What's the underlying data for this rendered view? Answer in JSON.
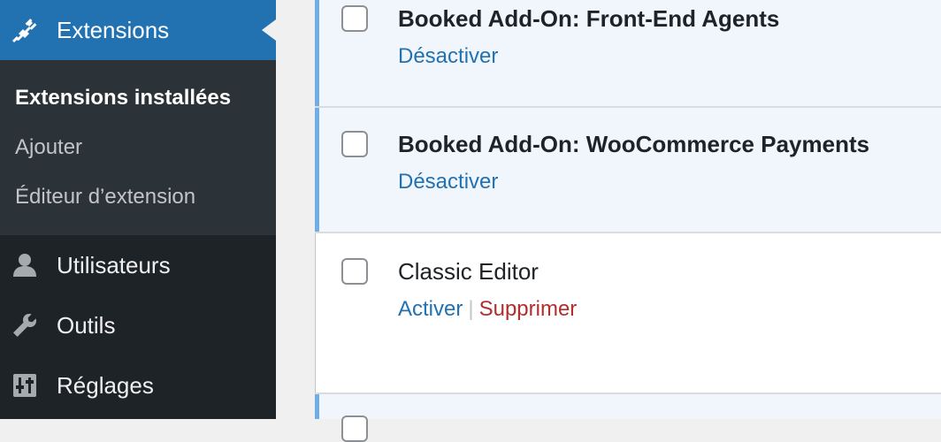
{
  "sidebar": {
    "active_menu": {
      "label": "Extensions",
      "icon": "plugin-icon"
    },
    "submenu": [
      {
        "label": "Extensions installées",
        "current": true
      },
      {
        "label": "Ajouter",
        "current": false
      },
      {
        "label": "Éditeur d’extension",
        "current": false
      }
    ],
    "items": [
      {
        "label": "Utilisateurs",
        "icon": "user-icon"
      },
      {
        "label": "Outils",
        "icon": "wrench-icon"
      },
      {
        "label": "Réglages",
        "icon": "settings-sliders-icon"
      }
    ]
  },
  "plugins": [
    {
      "name": "Booked Add-On: Front-End Agents",
      "active": true,
      "actions": [
        "Désactiver"
      ]
    },
    {
      "name": "Booked Add-On: WooCommerce Payments",
      "active": true,
      "actions": [
        "Désactiver"
      ]
    },
    {
      "name": "Classic Editor",
      "active": false,
      "actions": [
        "Activer",
        "Supprimer"
      ]
    }
  ],
  "colors": {
    "sidebar_bg": "#1d2327",
    "submenu_bg": "#2c3338",
    "accent": "#2271b1",
    "active_row_bg": "#f0f6fc",
    "active_row_border": "#72aee6",
    "delete": "#b32d2e"
  }
}
